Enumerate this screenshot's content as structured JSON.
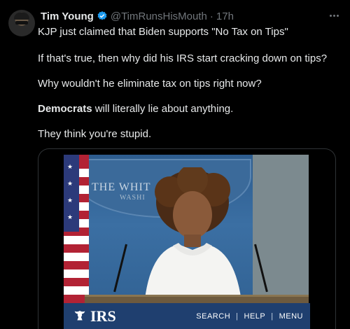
{
  "author": {
    "name": "Tim Young",
    "handle": "@TimRunsHisMouth",
    "separator": "·",
    "time": "17h"
  },
  "tweet": {
    "line1": "KJP just claimed that Biden supports \"No Tax on Tips\"",
    "line2": "If that's true, then why did his IRS start cracking down on tips?",
    "line3": "Why wouldn't he eliminate tax on tips right now?",
    "line4_bold": "Democrats",
    "line4_rest": " will literally lie about anything.",
    "line5": "They think you're stupid."
  },
  "video": {
    "backdrop_text": "THE WHIT",
    "backdrop_text2": "WASHI",
    "irs_logo_text": "IRS",
    "nav": [
      "SEARCH",
      "HELP",
      "MENU"
    ],
    "nav_separator": "|"
  },
  "colors": {
    "background": "#000000",
    "text": "#e7e9ea",
    "secondary_text": "#71767b",
    "verified_blue": "#1d9bf0",
    "irs_bar": "#1f3f6f"
  },
  "icons": {
    "verified": "verified-badge-icon",
    "more": "more-options-icon",
    "irs": "irs-eagle-icon"
  }
}
